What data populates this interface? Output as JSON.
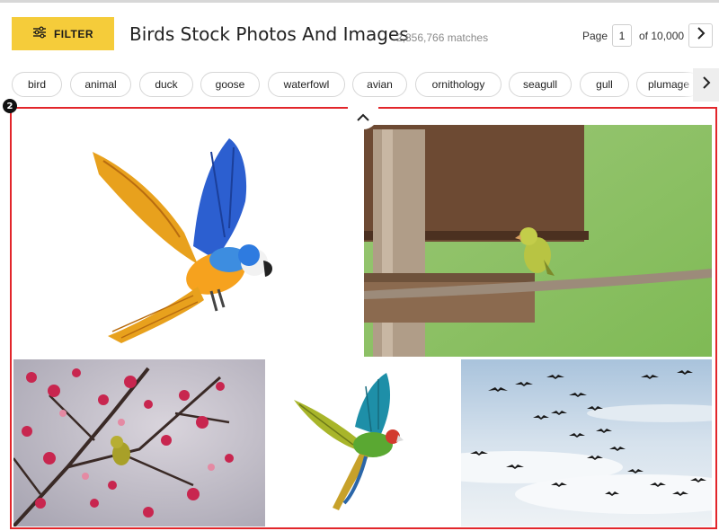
{
  "header": {
    "filter_label": "FILTER",
    "title": "Birds Stock Photos And Images",
    "matches": "2,856,766 matches",
    "page_label": "Page",
    "page_value": "1",
    "page_of": "of 10,000"
  },
  "chips": [
    "bird",
    "animal",
    "duck",
    "goose",
    "waterfowl",
    "avian",
    "ornithology",
    "seagull",
    "gull",
    "plumage"
  ],
  "annotation": {
    "badge": "2",
    "highlight_color": "#e2262b"
  },
  "colors": {
    "filter_button": "#f5cc3a",
    "chip_scroll_bg": "#eeeeee"
  },
  "icons": {
    "filter": "sliders-icon",
    "next_page": "chevron-right-icon",
    "chip_scroll": "chevron-right-icon",
    "collapse": "chevron-up-icon"
  }
}
